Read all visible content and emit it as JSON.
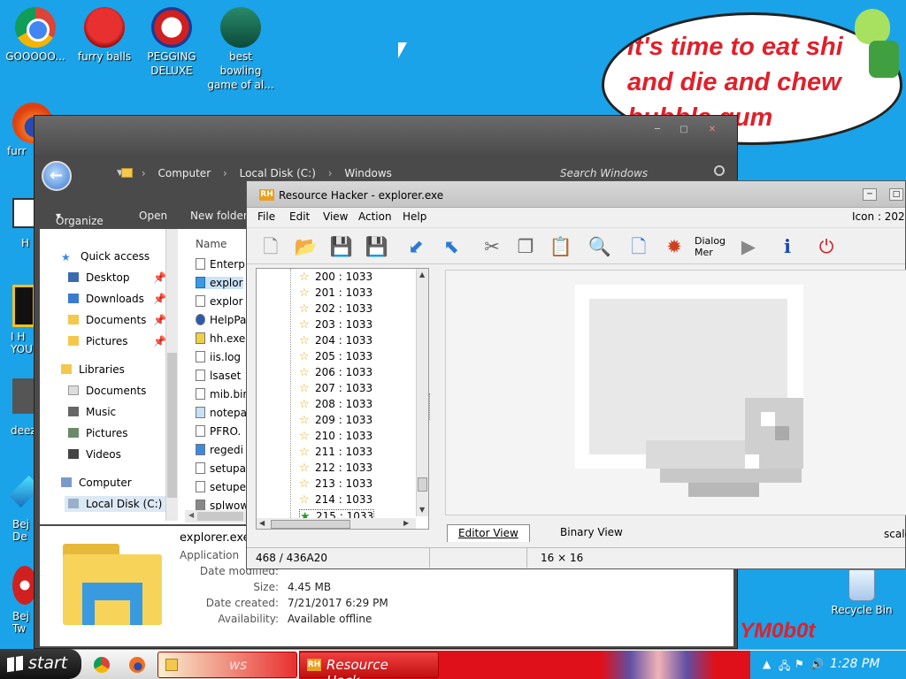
{
  "desktop": {
    "icons": [
      {
        "label": "GOOOOO...",
        "icon": "chrome-icon"
      },
      {
        "label": "furry balls",
        "icon": "furry-balls-icon"
      },
      {
        "label": "PEGGING DELUXE",
        "icon": "pegging-icon"
      },
      {
        "label": "best bowling game of al...",
        "icon": "bowling-icon"
      }
    ],
    "left_edge_labels": [
      "furr",
      "H",
      "I H YOU",
      "deez",
      "Bej De",
      "Bej Tw"
    ],
    "recycle_bin": "Recycle Bin",
    "bubble_lines": [
      "it's time to eat shi",
      "and die and chew",
      "bubble gum"
    ],
    "signature_text": "YM0b0t"
  },
  "explorer": {
    "breadcrumb": [
      "Computer",
      "Local Disk (C:)",
      "Windows"
    ],
    "search_placeholder": "Search Windows",
    "toolbar": {
      "organize": "Organize",
      "open": "Open",
      "new_folder": "New folder"
    },
    "nav": {
      "quick_access": "Quick access",
      "quick": [
        "Desktop",
        "Downloads",
        "Documents",
        "Pictures"
      ],
      "libraries": "Libraries",
      "libs": [
        "Documents",
        "Music",
        "Pictures",
        "Videos"
      ],
      "computer": "Computer",
      "local_disk": "Local Disk (C:)"
    },
    "column_name": "Name",
    "files": [
      "Enterp",
      "explor",
      "explor",
      "HelpPa",
      "hh.exe",
      "iis.log",
      "lsaset",
      "mib.bin",
      "notepa",
      "PFRO.",
      "regedi",
      "setupa",
      "setupe",
      "splwow"
    ],
    "details": {
      "name": "explorer.exe",
      "type": "Application",
      "date_modified_label": "Date modified:",
      "size_label": "Size:",
      "size": "4.45 MB",
      "date_created_label": "Date created:",
      "date_created": "7/21/2017 6:29 PM",
      "availability_label": "Availability:",
      "availability": "Available offline"
    }
  },
  "rh": {
    "title": "Resource Hacker - explorer.exe",
    "logo": "RH",
    "menu": [
      "File",
      "Edit",
      "View",
      "Action",
      "Help"
    ],
    "icon_indicator": "Icon : 202",
    "dialog_btn": "Dialog Mer",
    "tree": [
      "200 : 1033",
      "201 : 1033",
      "202 : 1033",
      "203 : 1033",
      "204 : 1033",
      "205 : 1033",
      "206 : 1033",
      "207 : 1033",
      "208 : 1033",
      "209 : 1033",
      "210 : 1033",
      "211 : 1033",
      "212 : 1033",
      "213 : 1033",
      "214 : 1033",
      "215 : 1033"
    ],
    "tabs": {
      "editor": "Editor View",
      "binary": "Binary View",
      "scale": "scale"
    },
    "status": {
      "offset": "468 / 436A20",
      "size": "16 × 16"
    }
  },
  "taskbar": {
    "start": "start",
    "tasks": [
      "ws",
      "Resource Hack..."
    ],
    "clock": "1:28 PM"
  }
}
